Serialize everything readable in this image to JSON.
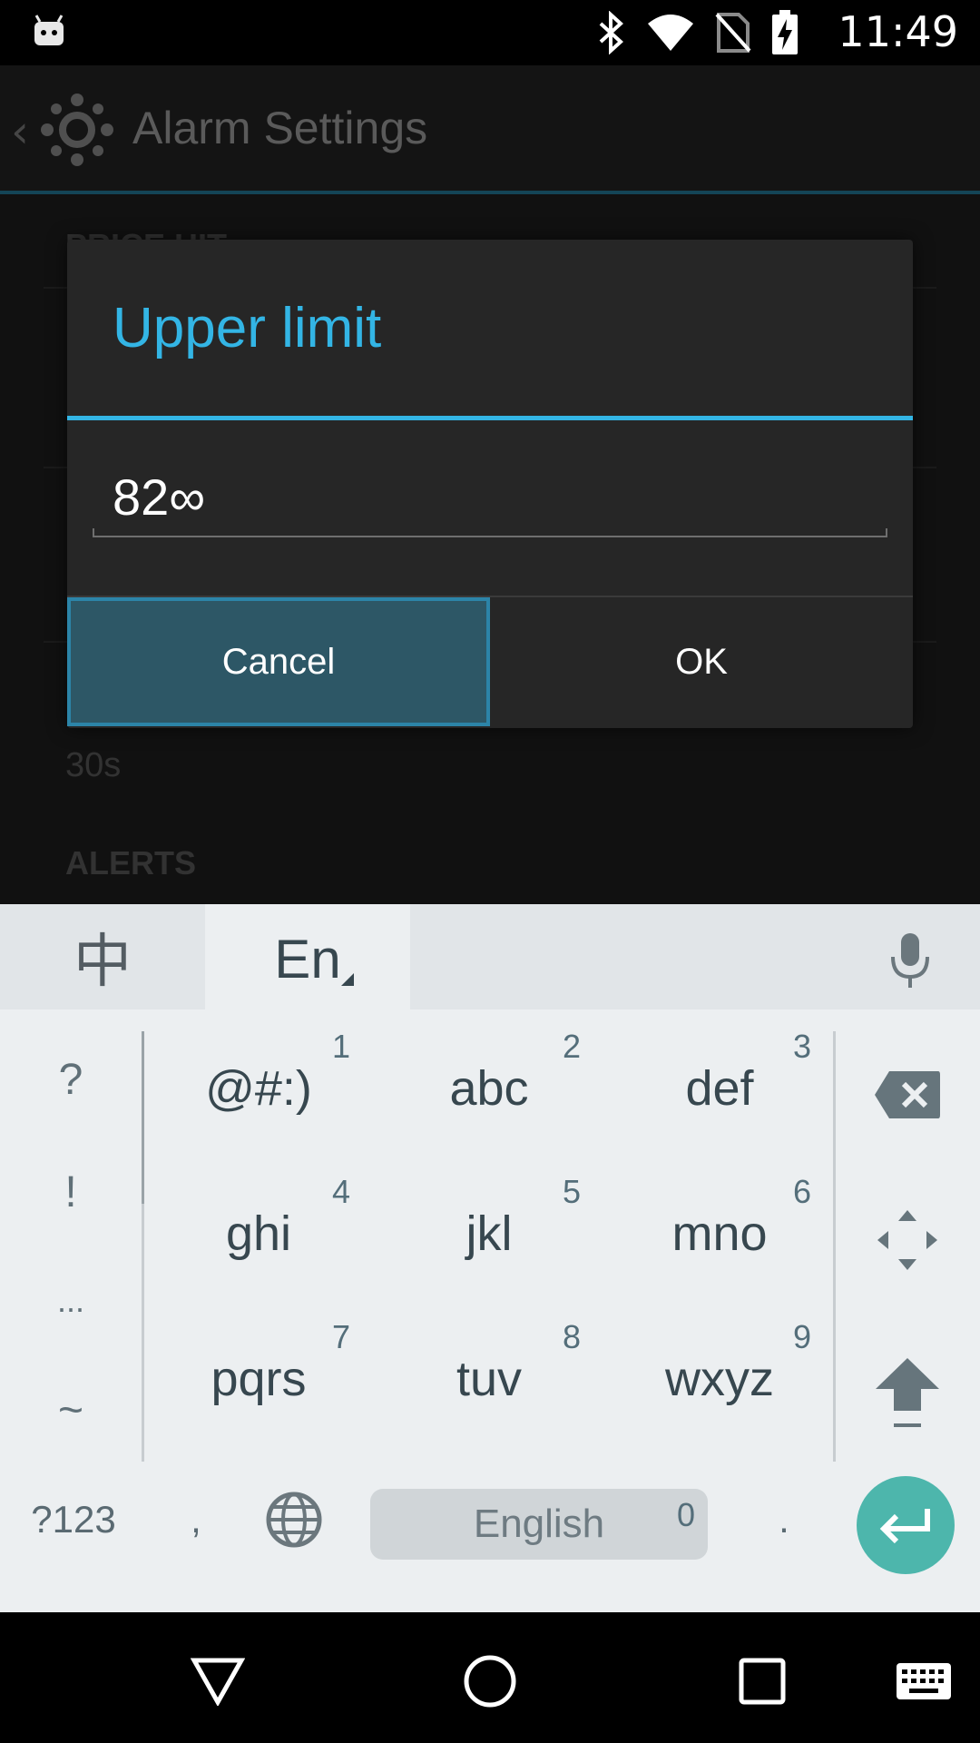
{
  "status_bar": {
    "time": "11:49",
    "icons": [
      "android-notification-icon",
      "bluetooth-icon",
      "wifi-icon",
      "no-sim-icon",
      "battery-charging-icon"
    ]
  },
  "action_bar": {
    "title": "Alarm Settings",
    "icons": [
      "back-chevron-icon",
      "app-logo-icon"
    ]
  },
  "background": {
    "section_header_top": "PRICE HIT",
    "value_30s": "30s",
    "section_header_alerts": "ALERTS"
  },
  "dialog": {
    "title": "Upper limit",
    "input_value": "82∞",
    "cancel_label": "Cancel",
    "ok_label": "OK",
    "accent_color": "#33b5e5"
  },
  "keyboard": {
    "lang_zh": "中",
    "lang_en": "En",
    "side_symbols": [
      "?",
      "!",
      "...",
      "~"
    ],
    "keys": [
      {
        "label": "@#:)",
        "num": "1"
      },
      {
        "label": "abc",
        "num": "2"
      },
      {
        "label": "def",
        "num": "3"
      },
      {
        "label": "ghi",
        "num": "4"
      },
      {
        "label": "jkl",
        "num": "5"
      },
      {
        "label": "mno",
        "num": "6"
      },
      {
        "label": "pqrs",
        "num": "7"
      },
      {
        "label": "tuv",
        "num": "8"
      },
      {
        "label": "wxyz",
        "num": "9"
      }
    ],
    "symbols_key": "?123",
    "comma_key": ",",
    "space_label": "English",
    "space_num": "0",
    "period_key": ".",
    "enter_color": "#4db6ac"
  },
  "nav_bar": {
    "icons": [
      "back-icon",
      "home-icon",
      "recents-icon",
      "keyboard-switch-icon"
    ]
  }
}
